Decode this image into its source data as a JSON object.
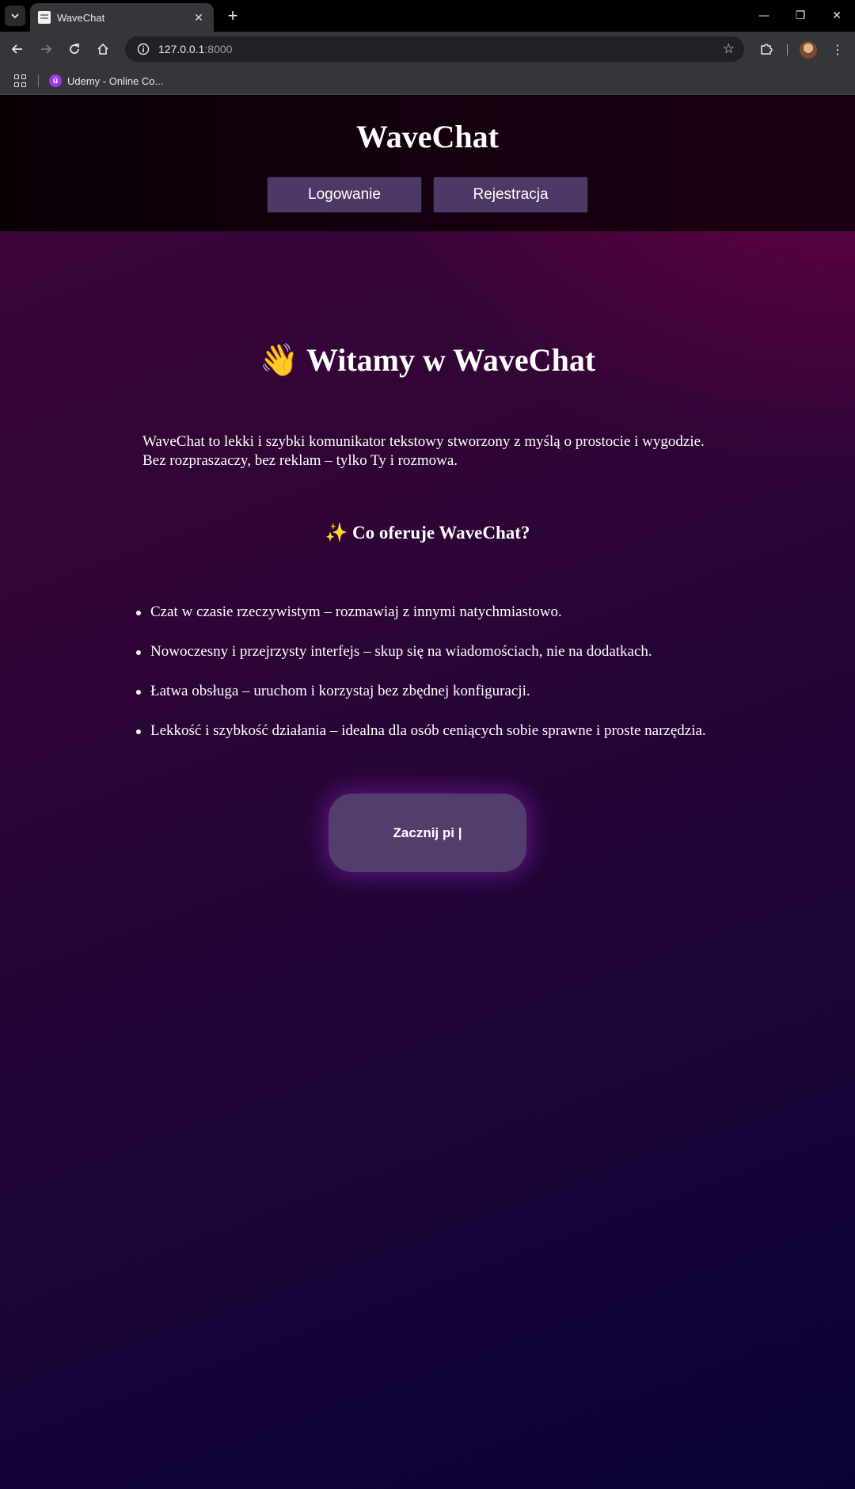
{
  "browser": {
    "tab_title": "WaveChat",
    "tab_close": "✕",
    "new_tab": "+",
    "url_host": "127.0.0.1",
    "url_port": ":8000",
    "bookmark_label": "Udemy - Online Co...",
    "bookmark_icon_letter": "ú",
    "window_controls": {
      "minimize": "—",
      "restore": "❐",
      "close": "✕"
    },
    "icons": {
      "tab_list": "chevron-down-icon",
      "back": "back-arrow-icon",
      "forward": "forward-arrow-icon",
      "reload": "reload-icon",
      "home": "home-icon",
      "site_info": "site-info-icon",
      "bookmark_star": "star-icon",
      "extensions": "puzzle-icon",
      "menu": "kebab-menu-icon",
      "apps": "apps-grid-icon"
    }
  },
  "header": {
    "title": "WaveChat",
    "login_label": "Logowanie",
    "register_label": "Rejestracja"
  },
  "main": {
    "welcome_emoji": "👋",
    "welcome_text": "Witamy w WaveChat",
    "intro": "WaveChat to lekki i szybki komunikator tekstowy stworzony z myślą o prostocie i wygodzie. Bez rozpraszaczy, bez reklam – tylko Ty i rozmowa.",
    "offer_emoji": "✨",
    "offer_heading": "Co oferuje WaveChat?",
    "features": [
      "Czat w czasie rzeczywistym – rozmawiaj z innymi natychmiastowo.",
      "Nowoczesny i przejrzysty interfejs – skup się na wiadomościach, nie na dodatkach.",
      "Łatwa obsługa – uruchom i korzystaj bez zbędnej konfiguracji.",
      "Lekkość i szybkość działania – idealna dla osób ceniących sobie sprawne i proste narzędzia."
    ],
    "start_label": "Zacznij pi |"
  },
  "colors": {
    "header_bg": "#0f000a",
    "button_bg": "#4d3966",
    "start_button_bg": "#523e6d",
    "glow": "#9628c8",
    "text": "#ffffff"
  }
}
